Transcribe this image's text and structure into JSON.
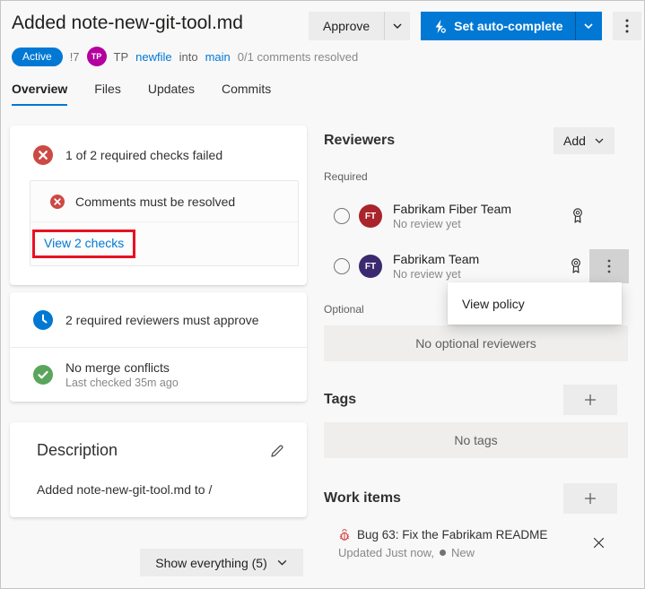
{
  "header": {
    "title": "Added note-new-git-tool.md",
    "approve_label": "Approve",
    "autocomplete_label": "Set auto-complete",
    "status_badge": "Active",
    "conflict_count": "!7",
    "author_initials": "TP",
    "author_name": "TP",
    "source_branch": "newfile",
    "into_label": "into",
    "target_branch": "main",
    "comments_status": "0/1 comments resolved"
  },
  "tabs": [
    {
      "label": "Overview",
      "active": true
    },
    {
      "label": "Files",
      "active": false
    },
    {
      "label": "Updates",
      "active": false
    },
    {
      "label": "Commits",
      "active": false
    }
  ],
  "checks": {
    "summary": "1 of 2 required checks failed",
    "detail": "Comments must be resolved",
    "view_link": "View 2 checks"
  },
  "requirements": {
    "reviewers_rule": "2 required reviewers must approve",
    "merge_title": "No merge conflicts",
    "merge_sub": "Last checked 35m ago"
  },
  "description": {
    "heading": "Description",
    "body": "Added note-new-git-tool.md to /"
  },
  "footer": {
    "show_everything": "Show everything (5)"
  },
  "reviewers": {
    "heading": "Reviewers",
    "add_label": "Add",
    "required_label": "Required",
    "optional_label": "Optional",
    "no_optional": "No optional reviewers",
    "menu_view_policy": "View policy",
    "list": [
      {
        "initials": "FT",
        "name": "Fabrikam Fiber Team",
        "status": "No review yet",
        "avatar_color": "#a9252b"
      },
      {
        "initials": "FT",
        "name": "Fabrikam Team",
        "status": "No review yet",
        "avatar_color": "#3b2a70"
      }
    ]
  },
  "tags": {
    "heading": "Tags",
    "empty": "No tags"
  },
  "work_items": {
    "heading": "Work items",
    "item": {
      "title": "Bug 63: Fix the Fabrikam README",
      "meta": "Updated Just now,",
      "state": "New"
    }
  },
  "colors": {
    "accent_blue": "#0078d4",
    "error_red": "#cd4a44",
    "success_green": "#5aa55c",
    "annotation_red": "#e81123",
    "author_avatar": "#b4009e",
    "reviewer1_avatar": "#a9252b",
    "reviewer2_avatar": "#3b2a70"
  }
}
